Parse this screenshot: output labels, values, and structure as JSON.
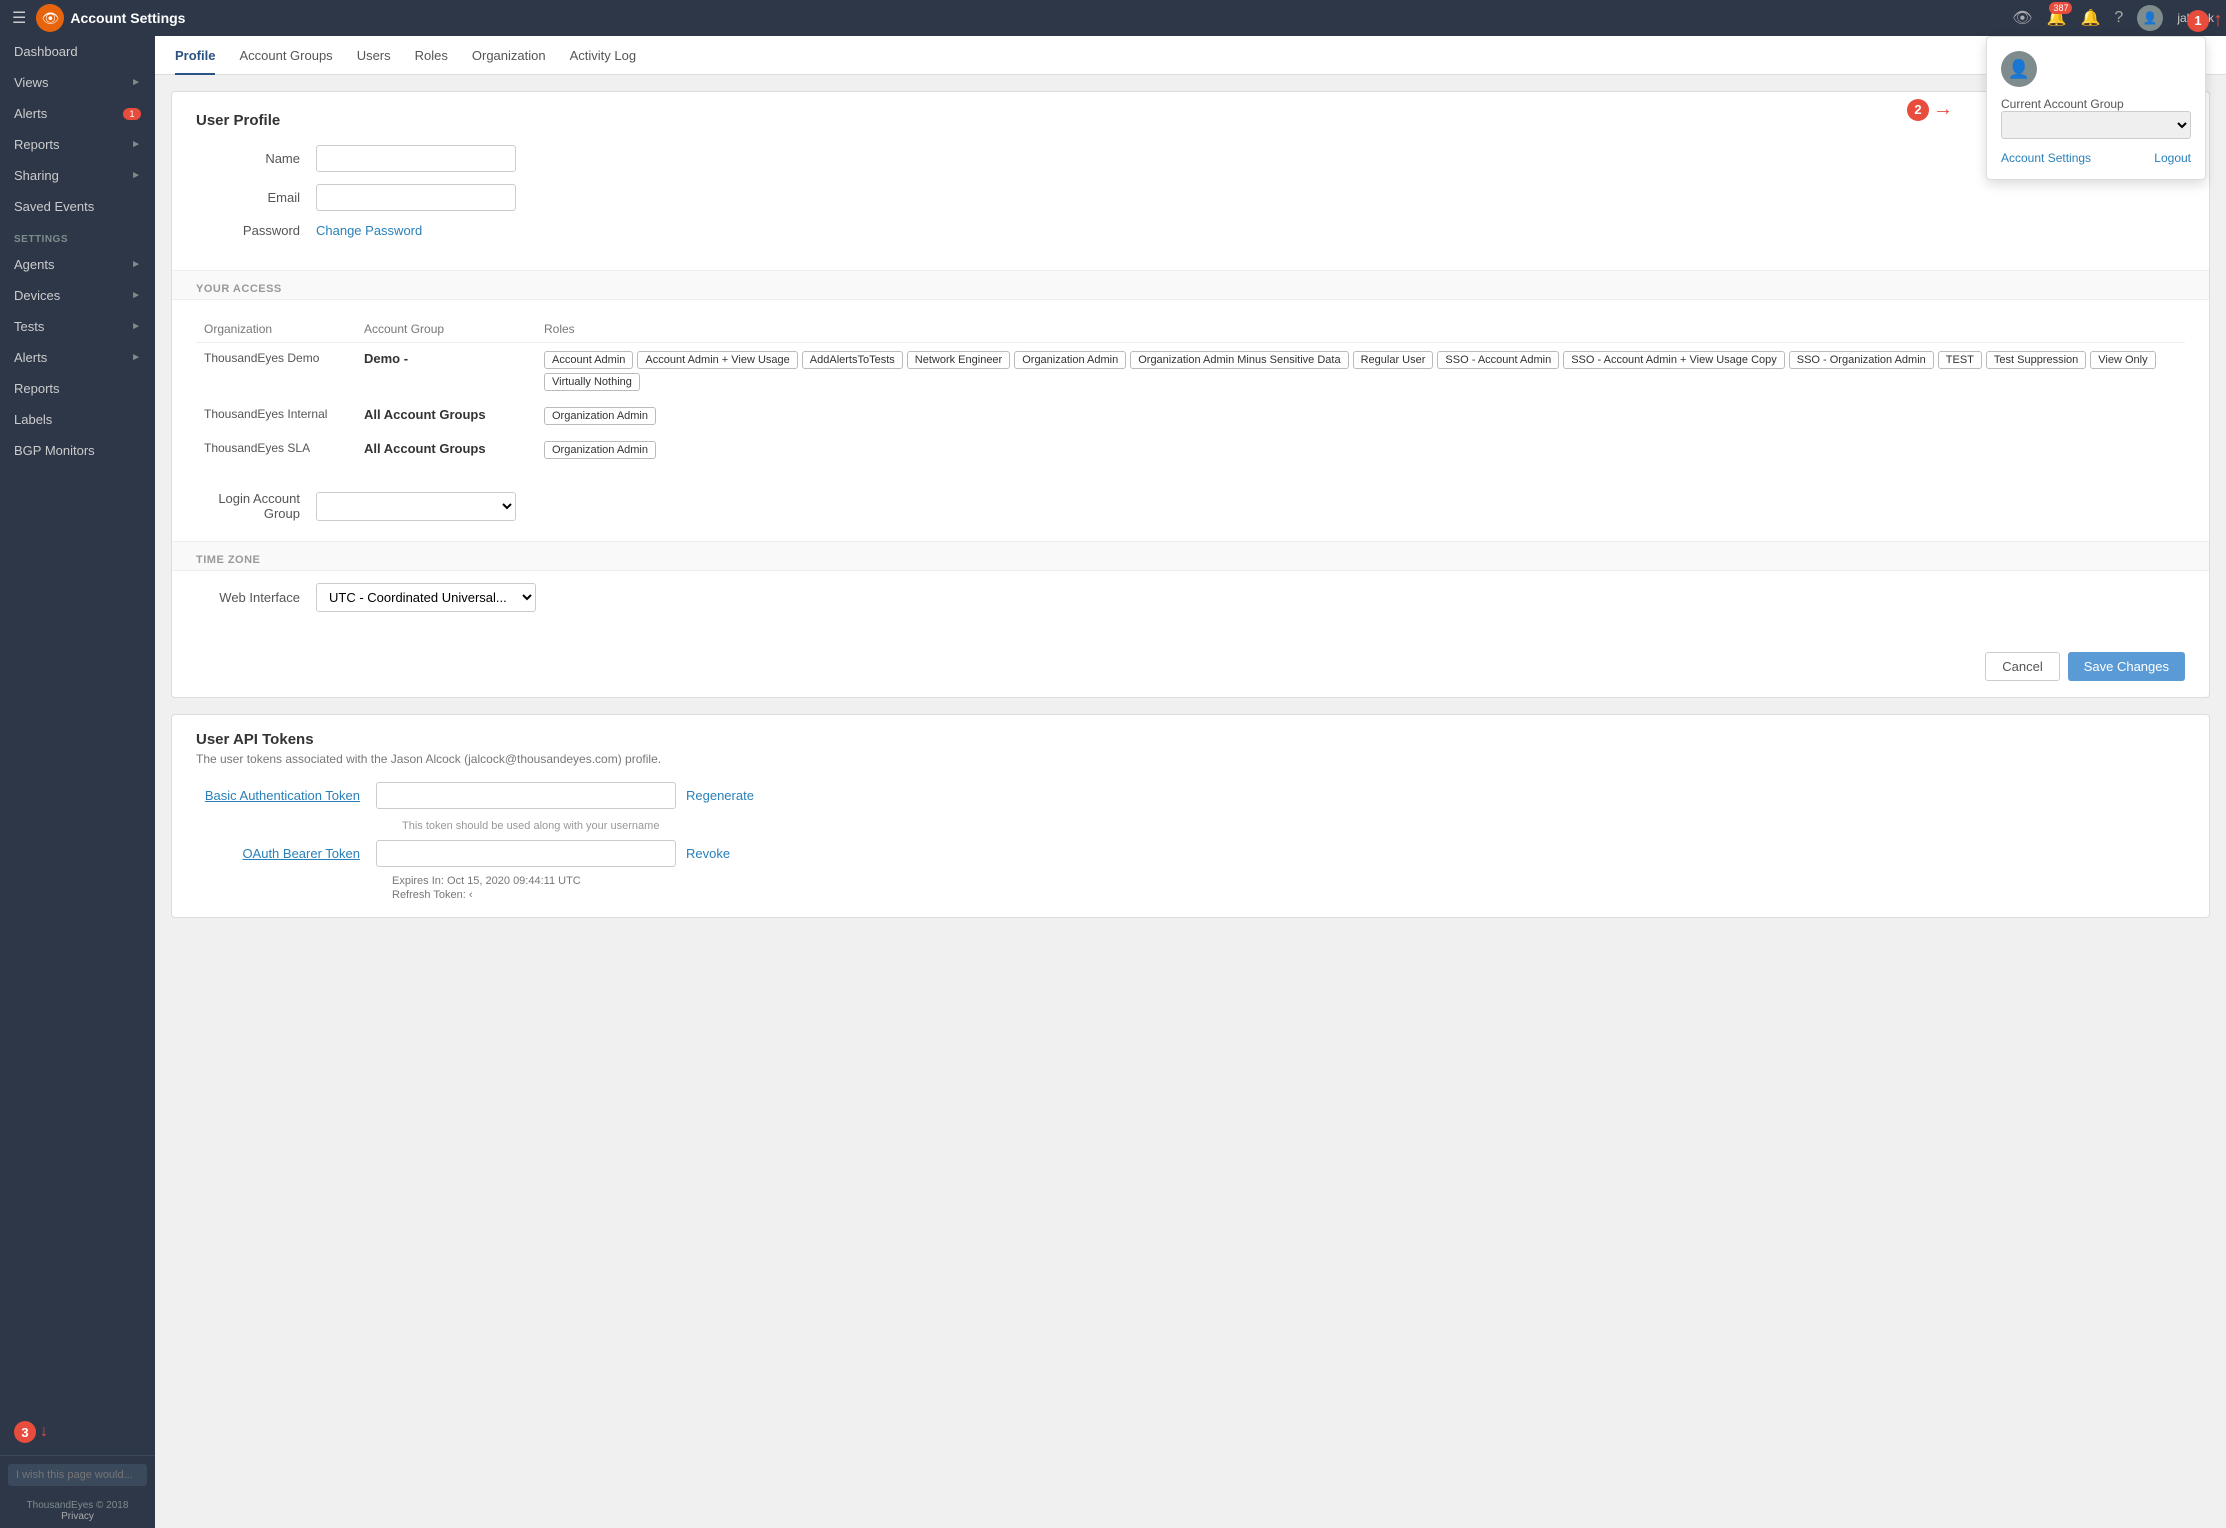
{
  "topbar": {
    "title": "Account Settings",
    "notification_count": "387",
    "username": "jalcock"
  },
  "sidebar": {
    "nav_items": [
      {
        "label": "Dashboard",
        "has_chevron": false,
        "badge": null
      },
      {
        "label": "Views",
        "has_chevron": true,
        "badge": null
      },
      {
        "label": "Alerts",
        "has_chevron": false,
        "badge": "1"
      },
      {
        "label": "Reports",
        "has_chevron": true,
        "badge": null
      },
      {
        "label": "Sharing",
        "has_chevron": true,
        "badge": null
      },
      {
        "label": "Saved Events",
        "has_chevron": false,
        "badge": null
      }
    ],
    "settings_items": [
      {
        "label": "Agents",
        "has_chevron": true
      },
      {
        "label": "Devices",
        "has_chevron": true
      },
      {
        "label": "Tests",
        "has_chevron": true
      },
      {
        "label": "Alerts",
        "has_chevron": true
      },
      {
        "label": "Reports",
        "has_chevron": false
      },
      {
        "label": "Labels",
        "has_chevron": false
      },
      {
        "label": "BGP Monitors",
        "has_chevron": false
      }
    ],
    "settings_label": "SETTINGS",
    "feedback_placeholder": "I wish this page would...",
    "copyright": "ThousandEyes © 2018",
    "privacy": "Privacy"
  },
  "tabs": [
    {
      "label": "Profile",
      "active": true
    },
    {
      "label": "Account Groups",
      "active": false
    },
    {
      "label": "Users",
      "active": false
    },
    {
      "label": "Roles",
      "active": false
    },
    {
      "label": "Organization",
      "active": false
    },
    {
      "label": "Activity Log",
      "active": false
    }
  ],
  "profile": {
    "section_title": "User Profile",
    "name_label": "Name",
    "name_placeholder": "",
    "email_label": "Email",
    "email_placeholder": "",
    "password_label": "Password",
    "change_password": "Change Password",
    "your_access_label": "YOUR ACCESS",
    "table_headers": [
      "Organization",
      "Account Group",
      "Roles"
    ],
    "access_rows": [
      {
        "org": "ThousandEyes Demo",
        "account_group": "Demo -",
        "roles": [
          "Account Admin",
          "Account Admin + View Usage",
          "AddAlertsToTests",
          "Network Engineer",
          "Organization Admin",
          "Organization Admin Minus Sensitive Data",
          "Regular User",
          "SSO - Account Admin",
          "SSO - Account Admin + View Usage Copy",
          "SSO - Organization Admin",
          "TEST",
          "Test Suppression",
          "View Only",
          "Virtually Nothing"
        ]
      },
      {
        "org": "ThousandEyes Internal",
        "account_group": "All Account Groups",
        "roles": [
          "Organization Admin"
        ]
      },
      {
        "org": "ThousandEyes SLA",
        "account_group": "All Account Groups",
        "roles": [
          "Organization Admin"
        ]
      }
    ],
    "login_account_group_label": "Login Account Group",
    "timezone_label": "TIME ZONE",
    "web_interface_label": "Web Interface",
    "timezone_value": "UTC - Coordinated Universal...",
    "cancel_label": "Cancel",
    "save_label": "Save Changes"
  },
  "api_tokens": {
    "title": "User API Tokens",
    "description": "The user tokens associated with the Jason Alcock (jalcock@thousandeyes.com) profile.",
    "basic_auth_label": "Basic Authentication Token",
    "basic_auth_value": "",
    "regenerate_label": "Regenerate",
    "basic_auth_hint": "This token should be used along with your username",
    "oauth_label": "OAuth Bearer Token",
    "oauth_value": "",
    "revoke_label": "Revoke",
    "expires_label": "Expires In: Oct 15, 2020 09:44:11 UTC",
    "refresh_label": "Refresh Token: ‹"
  },
  "dropdown": {
    "current_account_group_label": "Current Account Group",
    "account_settings_label": "Account Settings",
    "logout_label": "Logout"
  },
  "annotations": {
    "one": "1",
    "two": "2",
    "three": "3"
  }
}
